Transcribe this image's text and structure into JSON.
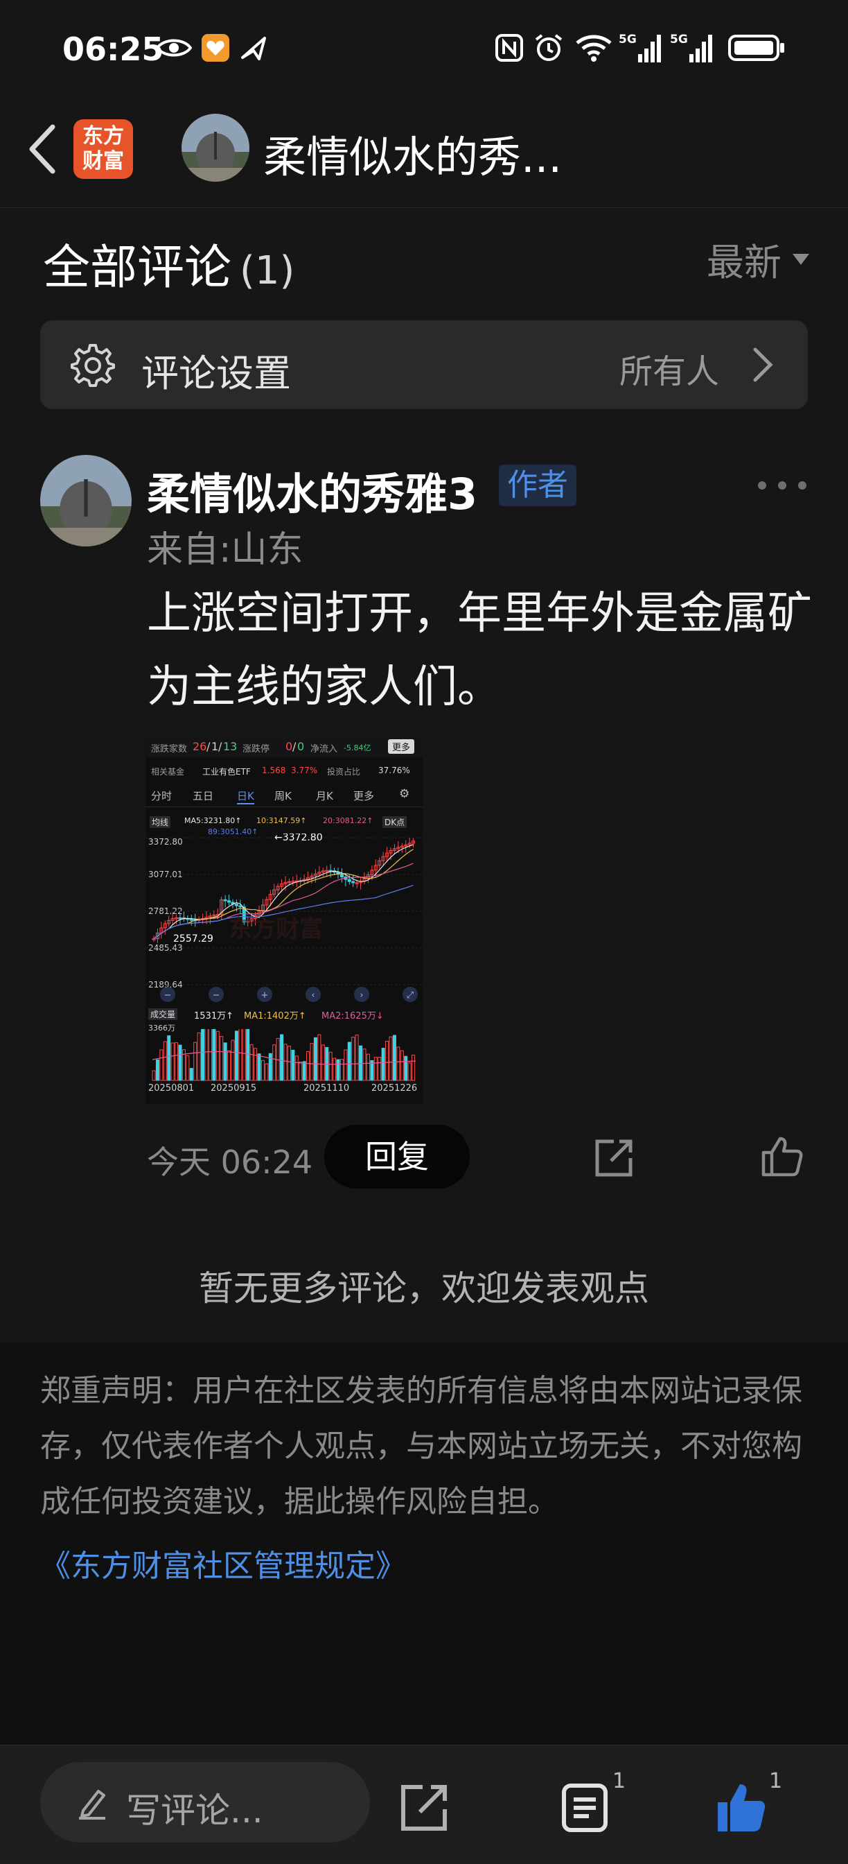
{
  "status_bar": {
    "time": "06:25",
    "icons": [
      "eye-icon",
      "app-notification-icon",
      "plane-arrow-icon",
      "nfc-icon",
      "alarm-icon",
      "wifi-icon",
      "signal-5g-icon",
      "signal-5g-icon",
      "battery-icon"
    ],
    "network_labels": [
      "5G",
      "5G"
    ]
  },
  "header": {
    "logo_text_line1": "东方",
    "logo_text_line2": "财富",
    "title": "柔情似水的秀..."
  },
  "comments_section": {
    "title": "全部评论",
    "count": "(1)",
    "sort_label": "最新"
  },
  "settings": {
    "label": "评论设置",
    "value": "所有人"
  },
  "comment": {
    "author": "柔情似水的秀雅3",
    "author_tag": "作者",
    "location": "来自:山东",
    "text": "上涨空间打开，年里年外是金属矿为主线的家人们。",
    "time": "今天 06:24",
    "reply_label": "回复"
  },
  "attached_chart": {
    "header": {
      "up_down_label": "涨跌家数",
      "up": "26",
      "flat": "1",
      "down": "13",
      "limit_label": "涨跌停",
      "limit_up": "0",
      "limit_down": "0",
      "inflow_label": "净流入",
      "inflow_value": "-5.84亿",
      "more_btn": "更多"
    },
    "fund_row": {
      "label": "相关基金",
      "fund_name": "工业有色ETF",
      "fund_price": "1.568",
      "fund_pct": "3.77%",
      "ratio_label": "投资占比",
      "ratio_value": "37.76%"
    },
    "tabs": [
      "分时",
      "五日",
      "日K",
      "周K",
      "月K",
      "更多"
    ],
    "active_tab": "日K",
    "ma_row": {
      "type_label": "均线",
      "ma5": "MA5:3231.80↑",
      "ma10": "10:3147.59↑",
      "ma20": "20:3081.22↑",
      "ma_extra": "89:3051.40↑",
      "dk_label": "DK点"
    },
    "price_axis": [
      "3372.80",
      "3077.01",
      "2781.22",
      "2485.43",
      "2189.64"
    ],
    "annotations": {
      "high": "←3372.80",
      "low": "2557.29"
    },
    "volume_row": {
      "label": "成交量",
      "vol": "1531万↑",
      "ma1": "MA1:1402万↑",
      "ma2": "MA2:1625万↓",
      "max": "3366万"
    },
    "dates": [
      "20250801",
      "20250915",
      "20251110",
      "20251226"
    ],
    "watermark": "东方财富"
  },
  "footer": {
    "no_more_text": "暂无更多评论，欢迎发表观点",
    "disclaimer": "郑重声明：用户在社区发表的所有信息将由本网站记录保存，仅代表作者个人观点，与本网站立场无关，不对您构成任何投资建议，据此操作风险自担。",
    "rules_link": "《东方财富社区管理规定》"
  },
  "bottom_bar": {
    "write_placeholder": "写评论...",
    "comment_count": "1",
    "like_count": "1"
  },
  "colors": {
    "background": "#161616",
    "accent_blue": "#4f8fe6",
    "logo_orange": "#e8542a",
    "up_red": "#ff4848",
    "down_cyan": "#3fd2e2"
  }
}
